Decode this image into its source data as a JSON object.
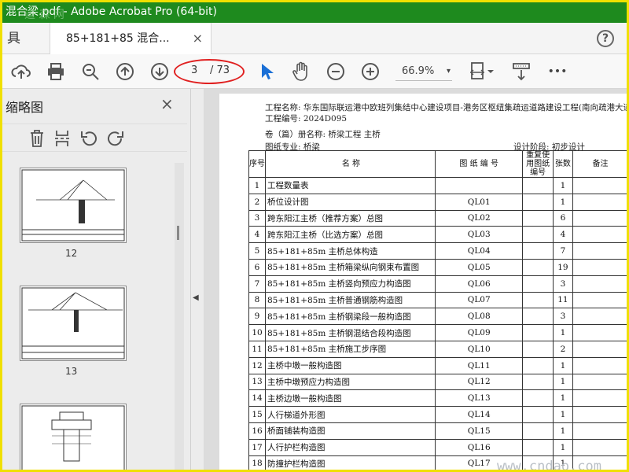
{
  "window": {
    "title": "混合梁.pdf - Adobe Acrobat Pro (64-bit)",
    "watermark_top": "道 森 网"
  },
  "tabs": {
    "tools_label": "具",
    "doc_tab_label": "85+181+85 混合...",
    "close_glyph": "×",
    "help_glyph": "?"
  },
  "toolbar": {
    "page_current": "3",
    "page_total": "/ 73",
    "zoom": "66.9%",
    "zoom_dropdown": "▾",
    "more": "•••"
  },
  "thumbnails": {
    "title": "缩略图",
    "close_glyph": "×",
    "pages": [
      "12",
      "13"
    ]
  },
  "document": {
    "project_name": "工程名称: 华东国际联运港中欧班列集结中心建设项目-港务区枢纽集疏运道路建设工程(南向疏港大道",
    "project_no": "工程编号:  2024D095",
    "volume": "卷（篇）册名称:  桥梁工程 主桥",
    "discipline": "图纸专业:  桥梁",
    "design_stage": "设计阶段:  初步设计",
    "headers": {
      "no": "序号",
      "name": "名               称",
      "drawing_no": "图 纸 编 号",
      "reused": "重复使用图纸编号",
      "sheets": "张数",
      "remarks": "备注"
    },
    "rows": [
      {
        "no": "1",
        "name": "工程数量表",
        "code": "",
        "sheets": "1"
      },
      {
        "no": "2",
        "name": "桥位设计图",
        "code": "QL01",
        "sheets": "1"
      },
      {
        "no": "3",
        "name": "跨东阳江主桥（推荐方案）总图",
        "code": "QL02",
        "sheets": "6"
      },
      {
        "no": "4",
        "name": "跨东阳江主桥（比选方案）总图",
        "code": "QL03",
        "sheets": "4"
      },
      {
        "no": "5",
        "name": "85+181+85m 主桥总体构造",
        "code": "QL04",
        "sheets": "7"
      },
      {
        "no": "6",
        "name": "85+181+85m 主桥箱梁纵向钢束布置图",
        "code": "QL05",
        "sheets": "19"
      },
      {
        "no": "7",
        "name": "85+181+85m 主桥竖向预应力构造图",
        "code": "QL06",
        "sheets": "3"
      },
      {
        "no": "8",
        "name": "85+181+85m 主桥普通钢筋构造图",
        "code": "QL07",
        "sheets": "11"
      },
      {
        "no": "9",
        "name": "85+181+85m 主桥钢梁段一般构造图",
        "code": "QL08",
        "sheets": "3"
      },
      {
        "no": "10",
        "name": "85+181+85m 主桥钢混结合段构造图",
        "code": "QL09",
        "sheets": "1"
      },
      {
        "no": "11",
        "name": "85+181+85m 主桥施工步序图",
        "code": "QL10",
        "sheets": "2"
      },
      {
        "no": "12",
        "name": "主桥中墩一般构造图",
        "code": "QL11",
        "sheets": "1"
      },
      {
        "no": "13",
        "name": "主桥中墩预应力构造图",
        "code": "QL12",
        "sheets": "1"
      },
      {
        "no": "14",
        "name": "主桥边墩一般构造图",
        "code": "QL13",
        "sheets": "1"
      },
      {
        "no": "15",
        "name": "人行梯道外形图",
        "code": "QL14",
        "sheets": "1"
      },
      {
        "no": "16",
        "name": "桥面铺装构造图",
        "code": "QL15",
        "sheets": "1"
      },
      {
        "no": "17",
        "name": "人行护栏构造图",
        "code": "QL16",
        "sheets": "1"
      },
      {
        "no": "18",
        "name": "防撞护栏构造图",
        "code": "QL17",
        "sheets": "1"
      }
    ]
  },
  "site_watermark": "www.cndao.com"
}
